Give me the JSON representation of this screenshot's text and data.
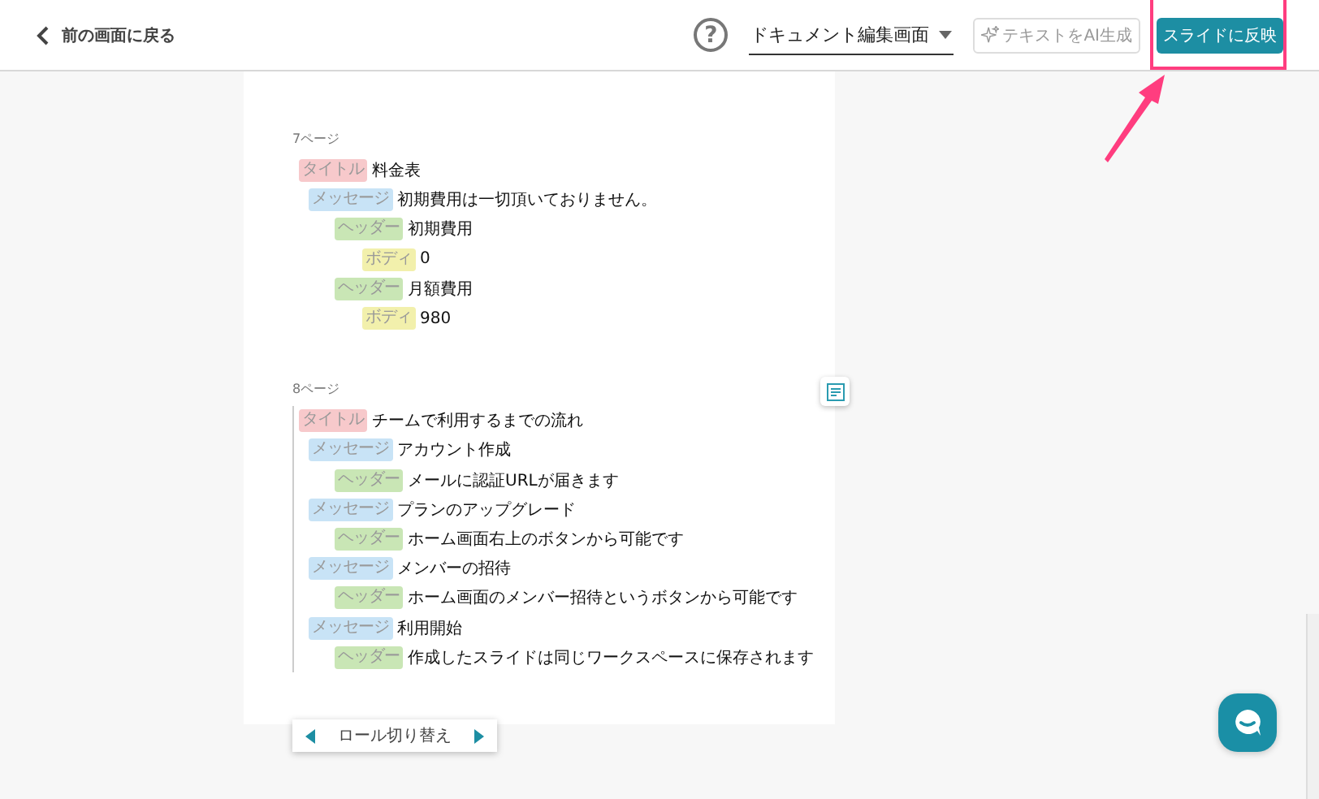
{
  "header": {
    "back_link": "前の画面に戻る",
    "help_label": "?",
    "view_select": {
      "value": "ドキュメント編集画面"
    },
    "ai_button": {
      "label": "テキストをAI生成",
      "disabled": true
    },
    "apply_button": {
      "label": "スライドに反映"
    }
  },
  "pages": [
    {
      "label": "7ページ",
      "selected": false,
      "items": [
        {
          "kind": "title",
          "tag": "タイトル",
          "text": "料金表",
          "children": [
            {
              "kind": "message",
              "tag": "メッセージ",
              "text": "初期費用は一切頂いておりません。",
              "children": [
                {
                  "kind": "header",
                  "tag": "ヘッダー",
                  "text": "初期費用",
                  "children": [
                    {
                      "kind": "body",
                      "tag": "ボディ",
                      "text": "0"
                    }
                  ]
                },
                {
                  "kind": "header",
                  "tag": "ヘッダー",
                  "text": "月額費用",
                  "children": [
                    {
                      "kind": "body",
                      "tag": "ボディ",
                      "text": "980"
                    }
                  ]
                }
              ]
            }
          ]
        }
      ]
    },
    {
      "label": "8ページ",
      "selected": true,
      "items": [
        {
          "kind": "title",
          "tag": "タイトル",
          "text": "チームで利用するまでの流れ",
          "children": [
            {
              "kind": "message",
              "tag": "メッセージ",
              "text": "アカウント作成",
              "children": [
                {
                  "kind": "header",
                  "tag": "ヘッダー",
                  "text": "メールに認証URLが届きます"
                }
              ]
            },
            {
              "kind": "message",
              "tag": "メッセージ",
              "text": "プランのアップグレード",
              "children": [
                {
                  "kind": "header",
                  "tag": "ヘッダー",
                  "text": "ホーム画面右上のボタンから可能です"
                }
              ]
            },
            {
              "kind": "message",
              "tag": "メッセージ",
              "text": "メンバーの招待",
              "children": [
                {
                  "kind": "header",
                  "tag": "ヘッダー",
                  "text": "ホーム画面のメンバー招待というボタンから可能です"
                }
              ]
            },
            {
              "kind": "message",
              "tag": "メッセージ",
              "text": "利用開始",
              "children": [
                {
                  "kind": "header",
                  "tag": "ヘッダー",
                  "text": "作成したスライドは同じワークスペースに保存されます"
                }
              ]
            }
          ]
        }
      ]
    }
  ],
  "role_switch": {
    "label": "ロール切り替え"
  }
}
